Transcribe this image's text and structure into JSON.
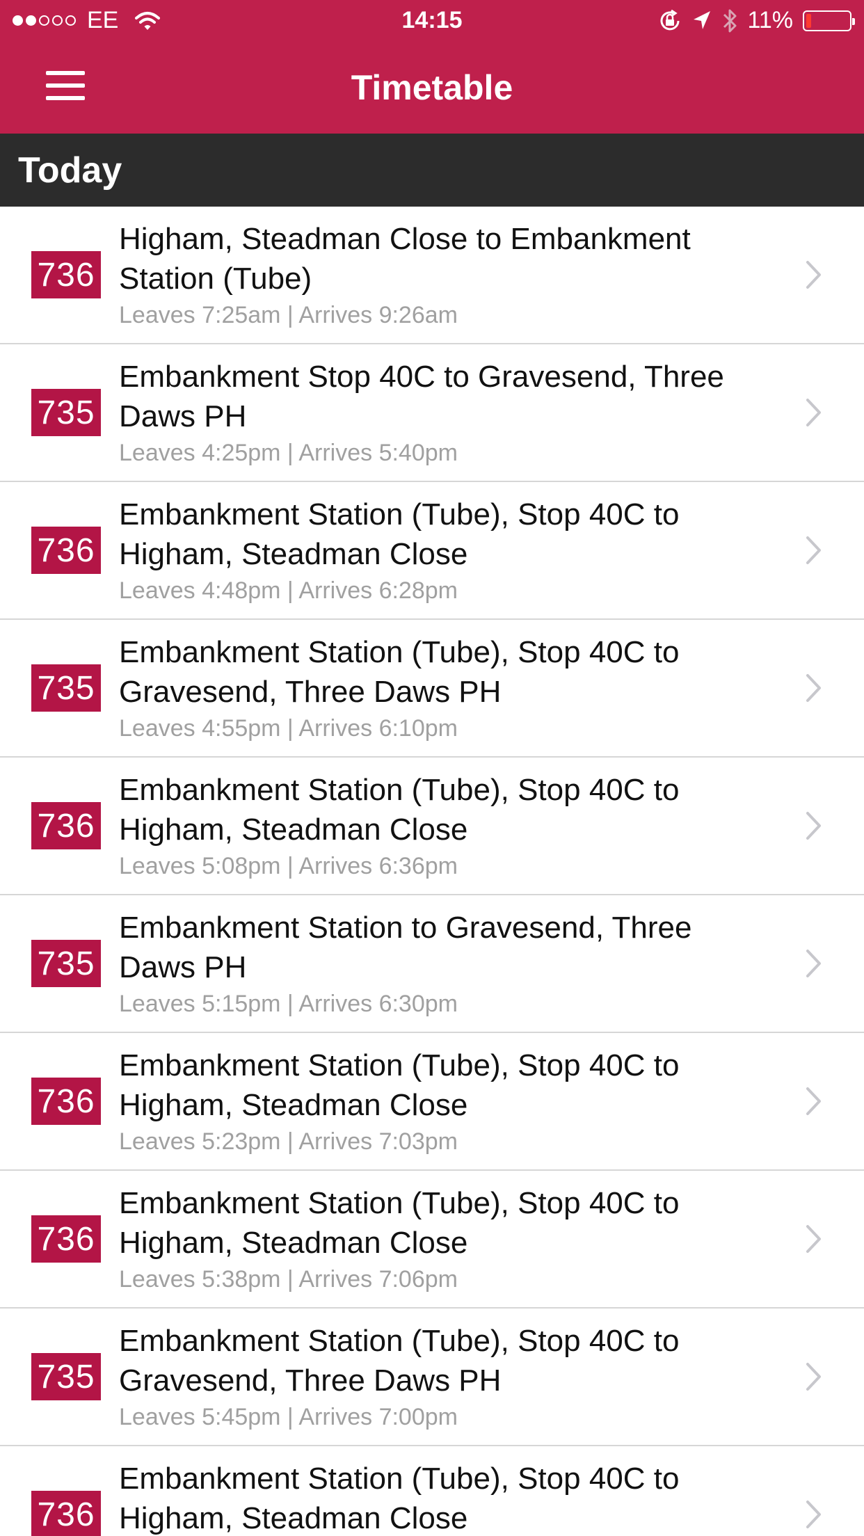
{
  "status_bar": {
    "carrier": "EE",
    "time": "14:15",
    "battery": "11%",
    "battery_level": 0.11,
    "signal_dots": 5,
    "signal_filled": 2
  },
  "nav": {
    "title": "Timetable",
    "menu_icon": "hamburger-menu-icon"
  },
  "section": {
    "title": "Today"
  },
  "colors": {
    "brand": "#bf204c",
    "badge": "#b31546",
    "section_header": "#2c2c2c",
    "subtext": "#a0a0a0"
  },
  "journeys": [
    {
      "route_number": "736",
      "route": "Higham, Steadman Close to Embankment Station (Tube)",
      "times": "Leaves 7:25am | Arrives 9:26am"
    },
    {
      "route_number": "735",
      "route": "Embankment Stop 40C to Gravesend, Three Daws PH",
      "times": "Leaves 4:25pm | Arrives 5:40pm"
    },
    {
      "route_number": "736",
      "route": "Embankment Station (Tube), Stop 40C to Higham, Steadman Close",
      "times": "Leaves 4:48pm | Arrives 6:28pm"
    },
    {
      "route_number": "735",
      "route": "Embankment Station (Tube), Stop 40C to Gravesend, Three Daws PH",
      "times": "Leaves 4:55pm | Arrives 6:10pm"
    },
    {
      "route_number": "736",
      "route": "Embankment Station (Tube), Stop 40C to Higham, Steadman Close",
      "times": "Leaves 5:08pm | Arrives 6:36pm"
    },
    {
      "route_number": "735",
      "route": "Embankment Station to Gravesend, Three Daws PH",
      "times": "Leaves 5:15pm | Arrives 6:30pm"
    },
    {
      "route_number": "736",
      "route": "Embankment Station (Tube), Stop 40C to Higham, Steadman Close",
      "times": "Leaves 5:23pm | Arrives 7:03pm"
    },
    {
      "route_number": "736",
      "route": "Embankment Station (Tube), Stop 40C to Higham, Steadman Close",
      "times": "Leaves 5:38pm | Arrives 7:06pm"
    },
    {
      "route_number": "735",
      "route": "Embankment Station (Tube), Stop 40C to Gravesend, Three Daws PH",
      "times": "Leaves 5:45pm | Arrives 7:00pm"
    },
    {
      "route_number": "736",
      "route": "Embankment Station (Tube), Stop 40C to Higham, Steadman Close",
      "times": ""
    }
  ]
}
